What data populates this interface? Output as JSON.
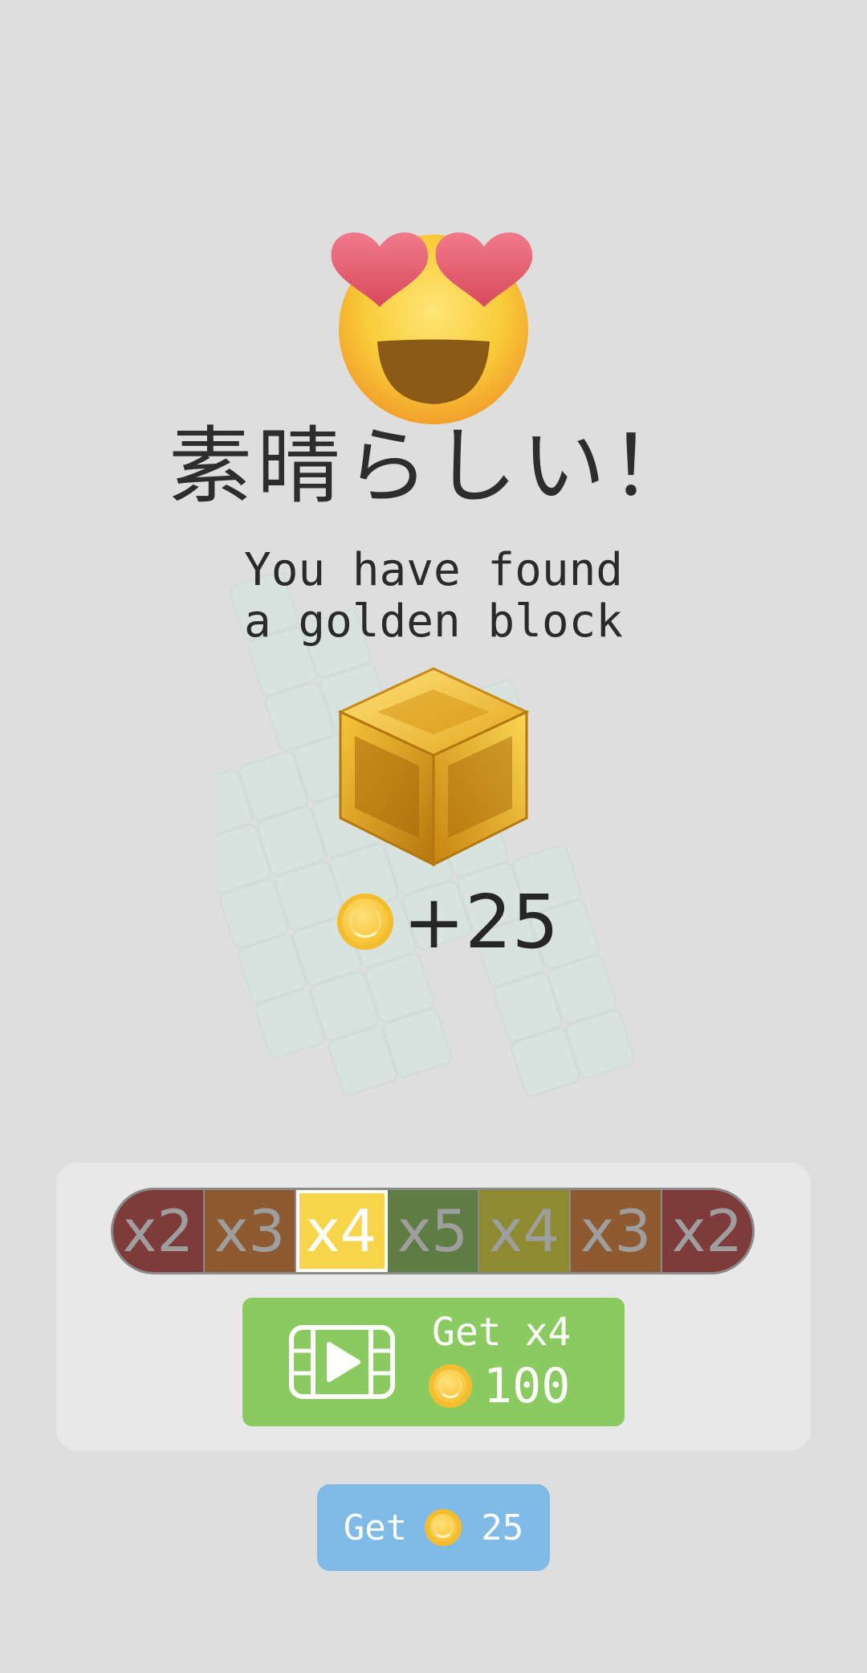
{
  "title": "素晴らしい！",
  "subtitle": {
    "line1": "You have found",
    "line2": "a golden block"
  },
  "reward": {
    "amount": "+25",
    "icon": "coin-icon"
  },
  "multipliers": {
    "items": [
      {
        "label": "x2",
        "color": "#7f3a3a"
      },
      {
        "label": "x3",
        "color": "#8e5a32"
      },
      {
        "label": "x4",
        "color": "#f7d54a",
        "active": true
      },
      {
        "label": "x5",
        "color": "#5d7d45"
      },
      {
        "label": "x4",
        "color": "#8e8a32"
      },
      {
        "label": "x3",
        "color": "#8e5a32"
      },
      {
        "label": "x2",
        "color": "#7f3a3a"
      }
    ]
  },
  "video_button": {
    "label": "Get x4",
    "cost": "100",
    "icon": "video-icon",
    "color": "#8aca60"
  },
  "get_button": {
    "label": "Get",
    "amount": "25",
    "color": "#7fbbe6"
  },
  "colors": {
    "background": "#dedede",
    "panel": "#e8e8e8",
    "coin": "#f7c63b"
  }
}
